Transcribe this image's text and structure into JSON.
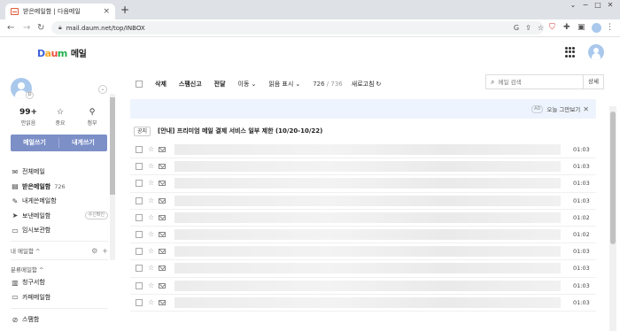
{
  "browser": {
    "tab_title": "받은메일함 | 다음메일",
    "tab_close": "×",
    "new_tab": "+",
    "url": "mail.daum.net/top/INBOX",
    "window_controls": [
      "⌄",
      "−",
      "□",
      "✕"
    ]
  },
  "header": {
    "logo_letters": [
      "D",
      "a",
      "u",
      "m"
    ],
    "logo_label": "메일"
  },
  "profile": {
    "badge": "D",
    "stats": [
      {
        "value": "99+",
        "label": "안읽음"
      },
      {
        "value": "",
        "label": "중요"
      },
      {
        "value": "",
        "label": "첨부"
      }
    ],
    "compose": "메일쓰기",
    "to_me": "내게쓰기"
  },
  "folders": [
    {
      "label": "전체메일",
      "icon": "inbox-all-icon",
      "count": "",
      "tag": ""
    },
    {
      "label": "받은메일함",
      "icon": "inbox-icon",
      "count": "726",
      "tag": ""
    },
    {
      "label": "내게쓴메일함",
      "icon": "note-icon",
      "count": "",
      "tag": ""
    },
    {
      "label": "보낸메일함",
      "icon": "send-icon",
      "count": "",
      "tag": "수신확인"
    },
    {
      "label": "임시보관함",
      "icon": "folder-icon",
      "count": "",
      "tag": ""
    }
  ],
  "my_mailbox": {
    "label": "내 메일함 ^"
  },
  "classified": {
    "label": "분류메일함 ^",
    "items": [
      {
        "label": "청구서함",
        "icon": "bill-icon"
      },
      {
        "label": "카페메일함",
        "icon": "cafe-icon"
      }
    ]
  },
  "spam": {
    "label": "스팸함"
  },
  "toolbar": {
    "delete": "삭제",
    "spam_report": "스팸신고",
    "forward": "전달",
    "move": "이동",
    "read_mark": "읽음 표시",
    "unread": "726",
    "total": "/ 736",
    "refresh": "새로고침"
  },
  "search": {
    "placeholder": "메일 검색",
    "button": "상세"
  },
  "banner": {
    "ad": "AD",
    "hide": "오늘 그만보기"
  },
  "notice": {
    "badge": "공지",
    "text": "[안내] 프리미엄 메일 결제 서비스 일부 제한 (10/20-10/22)"
  },
  "mails": [
    {
      "time": "01:03"
    },
    {
      "time": "01:03"
    },
    {
      "time": "01:03"
    },
    {
      "time": "01:03"
    },
    {
      "time": "01:02"
    },
    {
      "time": "01:02"
    },
    {
      "time": "01:03"
    },
    {
      "time": "01:03"
    },
    {
      "time": "01:03"
    },
    {
      "time": "01:03"
    }
  ]
}
